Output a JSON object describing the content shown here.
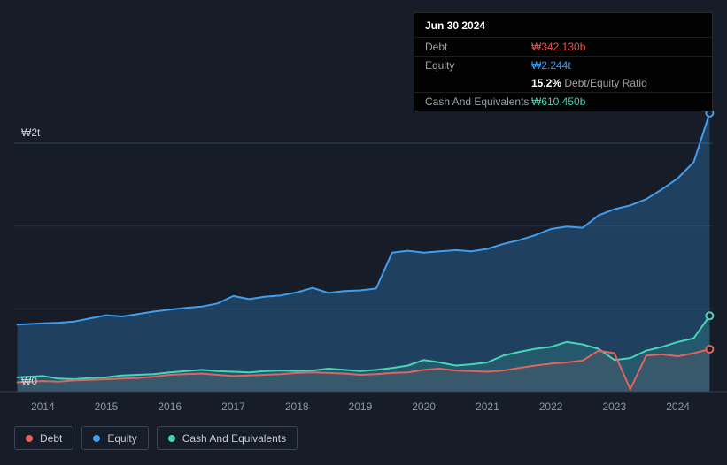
{
  "theme": {
    "background": "#161c28",
    "grid_color": "#262e3c",
    "grid_strong_color": "#39414e",
    "axis_line_color": "#39414e",
    "tick_text_color": "#8e97a3",
    "y_label_color": "#ccd1d9",
    "debt_color": "#e2635e",
    "equity_color": "#3e9ef0",
    "cash_color": "#45d6b8",
    "tooltip_background": "#020202",
    "tooltip_border": "#2b2b2b"
  },
  "tooltip": {
    "date": "Jun 30 2024",
    "debt_label": "Debt",
    "debt_value": "₩342.130b",
    "equity_label": "Equity",
    "equity_value": "₩2.244t",
    "ratio_value": "15.2%",
    "ratio_text": " Debt/Equity Ratio",
    "cash_label": "Cash And Equivalents",
    "cash_value": "₩610.450b"
  },
  "legend": {
    "items": [
      {
        "label": "Debt",
        "color": "#e2635e"
      },
      {
        "label": "Equity",
        "color": "#3e9ef0"
      },
      {
        "label": "Cash And Equivalents",
        "color": "#45d6b8"
      }
    ]
  },
  "chart_data": {
    "type": "area",
    "x_unit": "year",
    "y_unit": "KRW trillions",
    "x": [
      2013.6,
      2013.8,
      2014,
      2014.25,
      2014.5,
      2014.75,
      2015,
      2015.25,
      2015.5,
      2015.75,
      2016,
      2016.25,
      2016.5,
      2016.75,
      2017,
      2017.25,
      2017.5,
      2017.75,
      2018,
      2018.25,
      2018.5,
      2018.75,
      2019,
      2019.25,
      2019.5,
      2019.75,
      2020,
      2020.25,
      2020.5,
      2020.75,
      2021,
      2021.25,
      2021.5,
      2021.75,
      2022,
      2022.25,
      2022.5,
      2022.75,
      2023,
      2023.25,
      2023.5,
      2023.75,
      2024,
      2024.25,
      2024.5
    ],
    "series": [
      {
        "name": "Debt",
        "color": "#e2635e",
        "fill": "rgba(226,99,94,0.10)",
        "values": [
          0.075,
          0.08,
          0.085,
          0.08,
          0.09,
          0.095,
          0.1,
          0.105,
          0.11,
          0.12,
          0.135,
          0.14,
          0.145,
          0.135,
          0.125,
          0.13,
          0.135,
          0.14,
          0.15,
          0.155,
          0.15,
          0.145,
          0.135,
          0.14,
          0.15,
          0.155,
          0.175,
          0.185,
          0.17,
          0.165,
          0.16,
          0.17,
          0.19,
          0.21,
          0.225,
          0.235,
          0.25,
          0.33,
          0.31,
          0.02,
          0.29,
          0.3,
          0.285,
          0.31,
          0.342
        ]
      },
      {
        "name": "Equity",
        "color": "#3e9ef0",
        "fill": "rgba(62,158,240,0.28)",
        "values": [
          0.54,
          0.545,
          0.55,
          0.555,
          0.565,
          0.59,
          0.615,
          0.605,
          0.625,
          0.645,
          0.66,
          0.675,
          0.685,
          0.71,
          0.77,
          0.745,
          0.765,
          0.775,
          0.8,
          0.835,
          0.795,
          0.81,
          0.815,
          0.83,
          1.12,
          1.135,
          1.12,
          1.13,
          1.14,
          1.13,
          1.15,
          1.19,
          1.22,
          1.26,
          1.31,
          1.33,
          1.32,
          1.42,
          1.47,
          1.5,
          1.55,
          1.63,
          1.72,
          1.85,
          2.244
        ]
      },
      {
        "name": "Cash And Equivalents",
        "color": "#45d6b8",
        "fill": "rgba(69,214,184,0.16)",
        "values": [
          0.115,
          0.12,
          0.125,
          0.105,
          0.1,
          0.11,
          0.115,
          0.13,
          0.135,
          0.14,
          0.155,
          0.165,
          0.175,
          0.165,
          0.16,
          0.155,
          0.165,
          0.17,
          0.165,
          0.17,
          0.185,
          0.175,
          0.165,
          0.175,
          0.19,
          0.21,
          0.255,
          0.235,
          0.21,
          0.22,
          0.235,
          0.29,
          0.32,
          0.345,
          0.36,
          0.4,
          0.38,
          0.345,
          0.255,
          0.27,
          0.33,
          0.36,
          0.4,
          0.43,
          0.61
        ]
      }
    ],
    "xlim": [
      2013.55,
      2024.55
    ],
    "ylim": [
      0,
      2.3
    ],
    "x_ticks": [
      2014,
      2015,
      2016,
      2017,
      2018,
      2019,
      2020,
      2021,
      2022,
      2023,
      2024
    ],
    "y_gridlines": [
      0.667,
      1.333,
      2.0
    ],
    "y_ticks": [
      {
        "value": 2.0,
        "label": "₩2t"
      },
      {
        "value": 0,
        "label": "₩0"
      }
    ],
    "grid": true,
    "legend_position": "bottom-left"
  }
}
